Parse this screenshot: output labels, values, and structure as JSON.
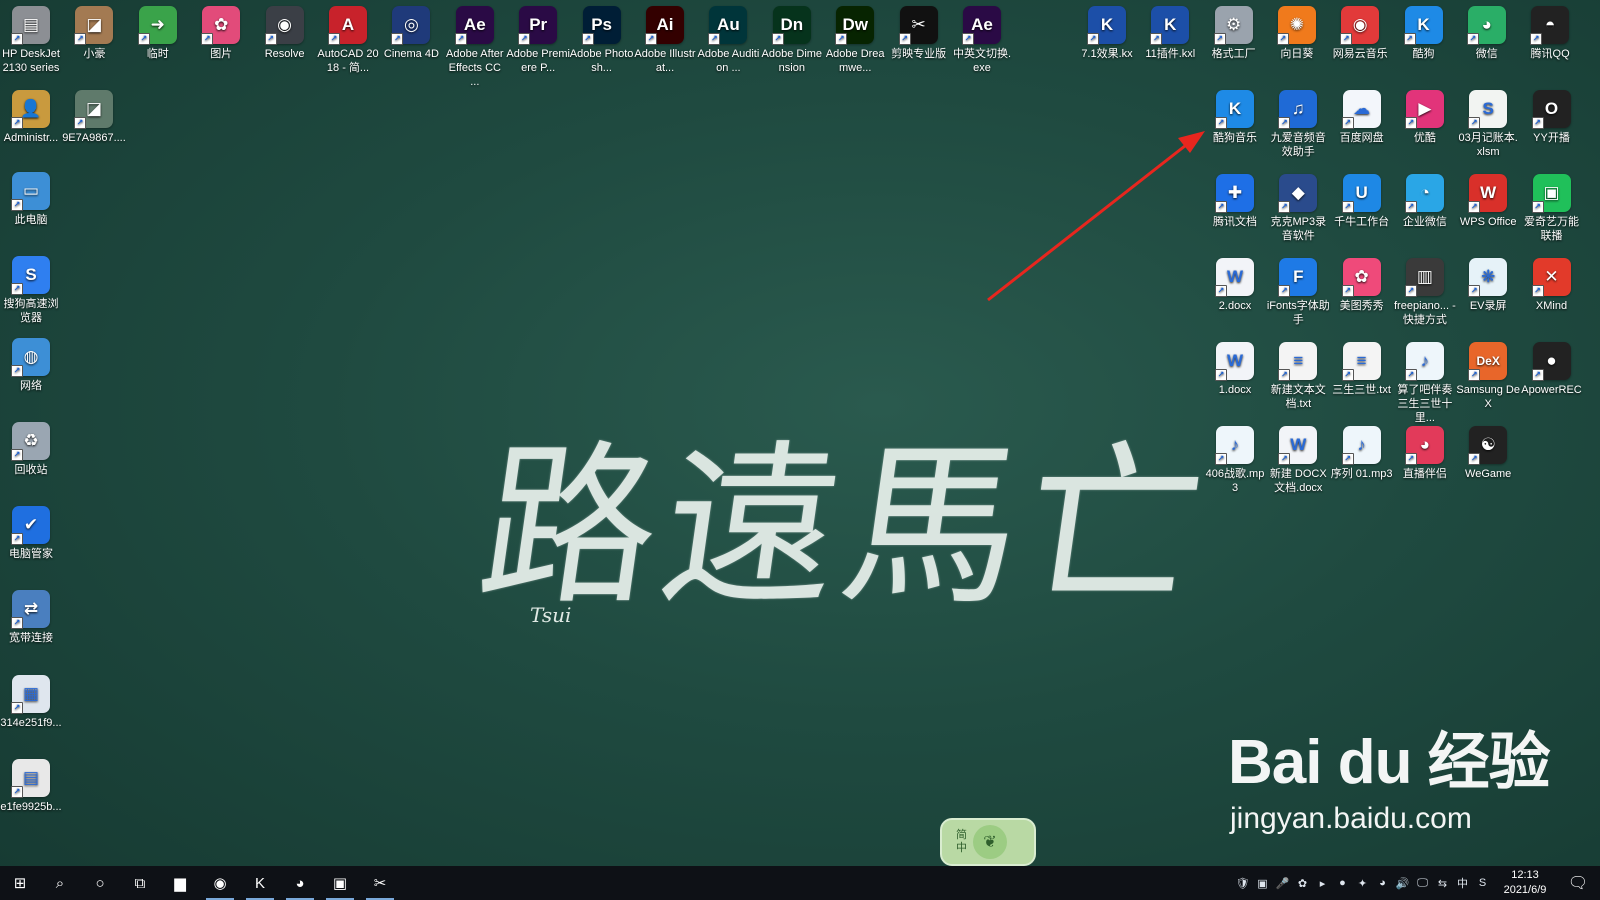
{
  "desktop_left": [
    {
      "label": "HP DeskJet 2130 series",
      "icon": "printer-icon",
      "color": "#8c8f94"
    },
    {
      "label": "小豪",
      "icon": "photo-icon",
      "color": "#a37a52"
    },
    {
      "label": "临时",
      "icon": "arrow-folder-icon",
      "color": "#3aa34a"
    },
    {
      "label": "图片",
      "icon": "photos-app-icon",
      "color": "#e24b7a"
    },
    {
      "label": "Resolve",
      "icon": "davinci-resolve-icon",
      "color": "#3b3f46"
    },
    {
      "label": "AutoCAD 2018 - 简...",
      "icon": "autocad-icon",
      "color": "#c8222b"
    },
    {
      "label": "Cinema 4D",
      "icon": "cinema4d-icon",
      "color": "#1f3a7a"
    },
    {
      "label": "Adobe After Effects CC ...",
      "icon": "after-effects-icon",
      "color": "#2a0a45"
    },
    {
      "label": "Adobe Premiere P...",
      "icon": "premiere-icon",
      "color": "#2a0a45"
    },
    {
      "label": "Adobe Photosh...",
      "icon": "photoshop-icon",
      "color": "#001e36"
    },
    {
      "label": "Adobe Illustrat...",
      "icon": "illustrator-icon",
      "color": "#330000"
    },
    {
      "label": "Adobe Audition ...",
      "icon": "audition-icon",
      "color": "#00353a"
    },
    {
      "label": "Adobe Dimension",
      "icon": "dimension-icon",
      "color": "#06331c"
    },
    {
      "label": "Adobe Dreamwe...",
      "icon": "dreamweaver-icon",
      "color": "#072401"
    },
    {
      "label": "剪映专业版",
      "icon": "capcut-icon",
      "color": "#111111"
    },
    {
      "label": "中英文切换.exe",
      "icon": "ae-switch-icon",
      "color": "#2a0a45"
    }
  ],
  "desktop_left_glyphs": [
    "▤",
    "◪",
    "➜",
    "✿",
    "◉",
    "A",
    "◎",
    "Ae",
    "Pr",
    "Ps",
    "Ai",
    "Au",
    "Dn",
    "Dw",
    "✂",
    "Ae"
  ],
  "desktop_col": [
    {
      "label": "Administr...",
      "icon": "user-folder-icon",
      "color": "#c99a3e",
      "glyph": "👤"
    },
    {
      "label": "9E7A9867....",
      "icon": "photo-icon",
      "color": "#5f7a6b",
      "glyph": "◪"
    },
    {
      "label": "此电脑",
      "icon": "computer-icon",
      "color": "#3d8fd6",
      "glyph": "▭"
    },
    {
      "label": "搜狗高速浏览器",
      "icon": "sogou-browser-icon",
      "color": "#2f7ff0",
      "glyph": "S"
    },
    {
      "label": "网络",
      "icon": "network-icon",
      "color": "#3d8fd6",
      "glyph": "◍"
    },
    {
      "label": "回收站",
      "icon": "recycle-bin-icon",
      "color": "#9aa6b2",
      "glyph": "♻"
    },
    {
      "label": "电脑管家",
      "icon": "pc-manager-icon",
      "color": "#1f6fe0",
      "glyph": "✔"
    },
    {
      "label": "宽带连接",
      "icon": "broadband-icon",
      "color": "#4a7fbf",
      "glyph": "⇄"
    },
    {
      "label": "314e251f9...",
      "icon": "image-file-icon",
      "color": "#dfe6ee",
      "glyph": "▦"
    },
    {
      "label": "e1fe9925b...",
      "icon": "image-file-icon",
      "color": "#e8e8e8",
      "glyph": "▤"
    }
  ],
  "desktop_right_top": [
    {
      "label": "7.1效果.kx",
      "icon": "kx-file-icon",
      "color": "#1c4fa8",
      "glyph": "K"
    },
    {
      "label": "11插件.kxl",
      "icon": "kxl-file-icon",
      "color": "#1c4fa8",
      "glyph": "K"
    },
    {
      "label": "格式工厂",
      "icon": "format-factory-icon",
      "color": "#9aa3ad",
      "glyph": "⚙"
    },
    {
      "label": "向日葵",
      "icon": "sunflower-icon",
      "color": "#f07a1c",
      "glyph": "✺"
    },
    {
      "label": "网易云音乐",
      "icon": "netease-music-icon",
      "color": "#e23a3a",
      "glyph": "◉"
    },
    {
      "label": "酷狗",
      "icon": "kugou-icon",
      "color": "#1e8ae6",
      "glyph": "K"
    },
    {
      "label": "微信",
      "icon": "wechat-icon",
      "color": "#2aae67",
      "glyph": "◕"
    },
    {
      "label": "腾讯QQ",
      "icon": "qq-icon",
      "color": "#222222",
      "glyph": "◓"
    }
  ],
  "desktop_grid": [
    [
      {
        "label": "酷狗音乐",
        "icon": "kugou-music-icon",
        "color": "#1e8ae6",
        "glyph": "K"
      },
      {
        "label": "九爱音频音效助手",
        "icon": "audio-assistant-icon",
        "color": "#1f6ad6",
        "glyph": "♫"
      },
      {
        "label": "百度网盘",
        "icon": "baidu-netdisk-icon",
        "color": "#f3f6fb",
        "glyph": "☁"
      },
      {
        "label": "优酷",
        "icon": "youku-icon",
        "color": "#e2347a",
        "glyph": "▶"
      },
      {
        "label": "03月记账本.xlsm",
        "icon": "spreadsheet-file-icon",
        "color": "#f2f4f2",
        "glyph": "S"
      },
      {
        "label": "YY开播",
        "icon": "yy-live-icon",
        "color": "#222222",
        "glyph": "O"
      }
    ],
    [
      {
        "label": "腾讯文档",
        "icon": "tencent-docs-icon",
        "color": "#1e6fe6",
        "glyph": "✚"
      },
      {
        "label": "克克MP3录音软件",
        "icon": "mp3-recorder-icon",
        "color": "#2a4b8c",
        "glyph": "◆"
      },
      {
        "label": "千牛工作台",
        "icon": "qianniu-icon",
        "color": "#1e88e5",
        "glyph": "U"
      },
      {
        "label": "企业微信",
        "icon": "wecom-icon",
        "color": "#2aa6e6",
        "glyph": "◔"
      },
      {
        "label": "WPS Office",
        "icon": "wps-icon",
        "color": "#d9302a",
        "glyph": "W"
      },
      {
        "label": "爱奇艺万能联播",
        "icon": "iqiyi-icon",
        "color": "#20c05a",
        "glyph": "▣"
      }
    ],
    [
      {
        "label": "2.docx",
        "icon": "word-file-icon",
        "color": "#f2f4f8",
        "glyph": "W"
      },
      {
        "label": "iFonts字体助手",
        "icon": "ifonts-icon",
        "color": "#1e7ae6",
        "glyph": "F"
      },
      {
        "label": "美图秀秀",
        "icon": "meitu-icon",
        "color": "#ef4a7a",
        "glyph": "✿"
      },
      {
        "label": "freepiano... - 快捷方式",
        "icon": "freepiano-icon",
        "color": "#3a3a3a",
        "glyph": "▥"
      },
      {
        "label": "EV录屏",
        "icon": "ev-recorder-icon",
        "color": "#e6f2f8",
        "glyph": "❋"
      },
      {
        "label": "XMind",
        "icon": "xmind-icon",
        "color": "#e23a2a",
        "glyph": "✕"
      }
    ],
    [
      {
        "label": "1.docx",
        "icon": "word-file-icon",
        "color": "#f2f4f8",
        "glyph": "W"
      },
      {
        "label": "新建文本文档.txt",
        "icon": "text-file-icon",
        "color": "#f4f4f4",
        "glyph": "≡"
      },
      {
        "label": "三生三世.txt",
        "icon": "text-file-icon",
        "color": "#f4f4f4",
        "glyph": "≡"
      },
      {
        "label": "算了吧伴奏三生三世十里...",
        "icon": "mp3-file-icon",
        "color": "#eef6fb",
        "glyph": "♪"
      },
      {
        "label": "Samsung DeX",
        "icon": "samsung-dex-icon",
        "color": "#e8662a",
        "glyph": "DeX"
      },
      {
        "label": "ApowerREC",
        "icon": "apowerrec-icon",
        "color": "#222222",
        "glyph": "●"
      }
    ],
    [
      {
        "label": "406战歌.mp3",
        "icon": "mp3-file-icon",
        "color": "#eef6fb",
        "glyph": "♪"
      },
      {
        "label": "新建 DOCX 文档.docx",
        "icon": "word-file-icon",
        "color": "#f2f4f8",
        "glyph": "W"
      },
      {
        "label": "序列 01.mp3",
        "icon": "mp3-file-icon",
        "color": "#eef6fb",
        "glyph": "♪"
      },
      {
        "label": "直播伴侣",
        "icon": "live-companion-icon",
        "color": "#e23a5a",
        "glyph": "◕"
      },
      {
        "label": "WeGame",
        "icon": "wegame-icon",
        "color": "#222222",
        "glyph": "☯"
      }
    ]
  ],
  "hero": {
    "calligraphy": "路遠馬亡",
    "signature": "Tsui"
  },
  "watermark": {
    "logo": "Bai du 经验",
    "url": "jingyan.baidu.com"
  },
  "ime": {
    "line1": "简",
    "line2": "中"
  },
  "taskbar": {
    "apps": [
      {
        "name": "start-button",
        "glyph": "⊞",
        "active": false
      },
      {
        "name": "search-button",
        "glyph": "⌕",
        "active": false
      },
      {
        "name": "cortana-button",
        "glyph": "○",
        "active": false
      },
      {
        "name": "task-view-button",
        "glyph": "⧉",
        "active": false
      },
      {
        "name": "file-explorer-taskbar",
        "glyph": "▆",
        "active": false
      },
      {
        "name": "edge-taskbar",
        "glyph": "◉",
        "active": true
      },
      {
        "name": "kx-taskbar",
        "glyph": "K",
        "active": true
      },
      {
        "name": "wechat-taskbar",
        "glyph": "◕",
        "active": true
      },
      {
        "name": "app-taskbar",
        "glyph": "▣",
        "active": true
      },
      {
        "name": "capcut-taskbar",
        "glyph": "✂",
        "active": true
      }
    ],
    "tray": [
      "🛡",
      "▣",
      "🎤",
      "✿",
      "▸",
      "●",
      "✦",
      "◕",
      "🔊",
      "🖵",
      "⇆",
      "中",
      "S"
    ],
    "time": "12:13",
    "date": "2021/6/9",
    "notification_count": "1"
  }
}
